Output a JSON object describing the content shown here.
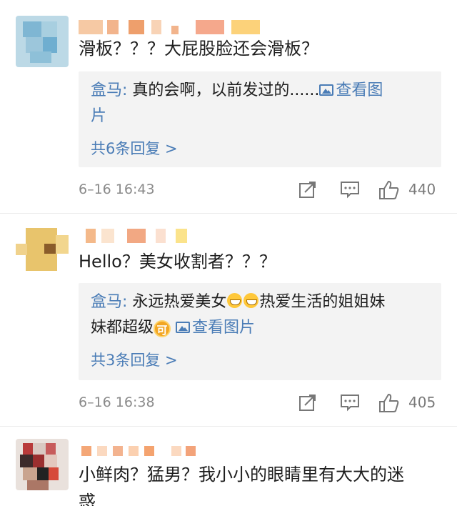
{
  "comments": [
    {
      "text": "滑板？？？大屁股脸还会滑板？",
      "reply": {
        "author": "盒马:",
        "content_line1": " 真的会啊，以前发过的......",
        "view_image": "查看图",
        "content_line2": "片",
        "more": "共6条回复 >"
      },
      "time": "6–16 16:43",
      "likes": "440"
    },
    {
      "text": "Hello？美女收割者？？？",
      "reply": {
        "author": "盒马:",
        "content_line1a": " 永远热爱美女",
        "content_line1b": "热爱生活的姐姐妹",
        "content_line2": "妹都超级",
        "emoji_ke": "可",
        "view_image": "查看图片",
        "more": "共3条回复 >"
      },
      "time": "6–16 16:38",
      "likes": "405"
    },
    {
      "text": "小鲜肉？猛男？我小小的眼睛里有大大的迷",
      "text_line2": "惑"
    }
  ],
  "icons": {
    "repost": "repost-icon",
    "comment": "comment-icon",
    "like": "thumbs-up-icon"
  },
  "colors": {
    "link": "#4a7cb6",
    "reply_bg": "#f3f3f3",
    "meta": "#8a8a8a"
  }
}
